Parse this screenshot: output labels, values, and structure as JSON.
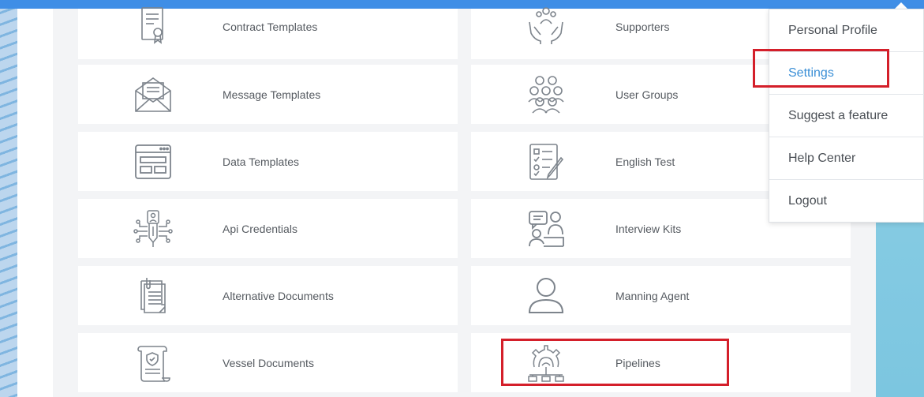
{
  "cards": [
    {
      "label": "Contract Templates",
      "icon": "contract-icon"
    },
    {
      "label": "Supporters",
      "icon": "supporters-icon"
    },
    {
      "label": "Message Templates",
      "icon": "envelope-icon"
    },
    {
      "label": "User Groups",
      "icon": "user-group-icon"
    },
    {
      "label": "Data Templates",
      "icon": "window-layout-icon"
    },
    {
      "label": "English Test",
      "icon": "test-checklist-icon"
    },
    {
      "label": "Api Credentials",
      "icon": "api-key-icon"
    },
    {
      "label": "Interview Kits",
      "icon": "interview-icon"
    },
    {
      "label": "Alternative Documents",
      "icon": "documents-icon"
    },
    {
      "label": "Manning Agent",
      "icon": "person-icon"
    },
    {
      "label": "Vessel Documents",
      "icon": "scroll-shield-icon"
    },
    {
      "label": "Pipelines",
      "icon": "pipeline-gear-icon"
    }
  ],
  "menu": {
    "items": [
      {
        "label": "Personal Profile"
      },
      {
        "label": "Settings"
      },
      {
        "label": "Suggest a feature"
      },
      {
        "label": "Help Center"
      },
      {
        "label": "Logout"
      }
    ]
  },
  "colors": {
    "topbar": "#3f8ee6",
    "active_menu": "#3b8fd6",
    "highlight": "#d41f2a",
    "icon_stroke": "#7d848c"
  }
}
